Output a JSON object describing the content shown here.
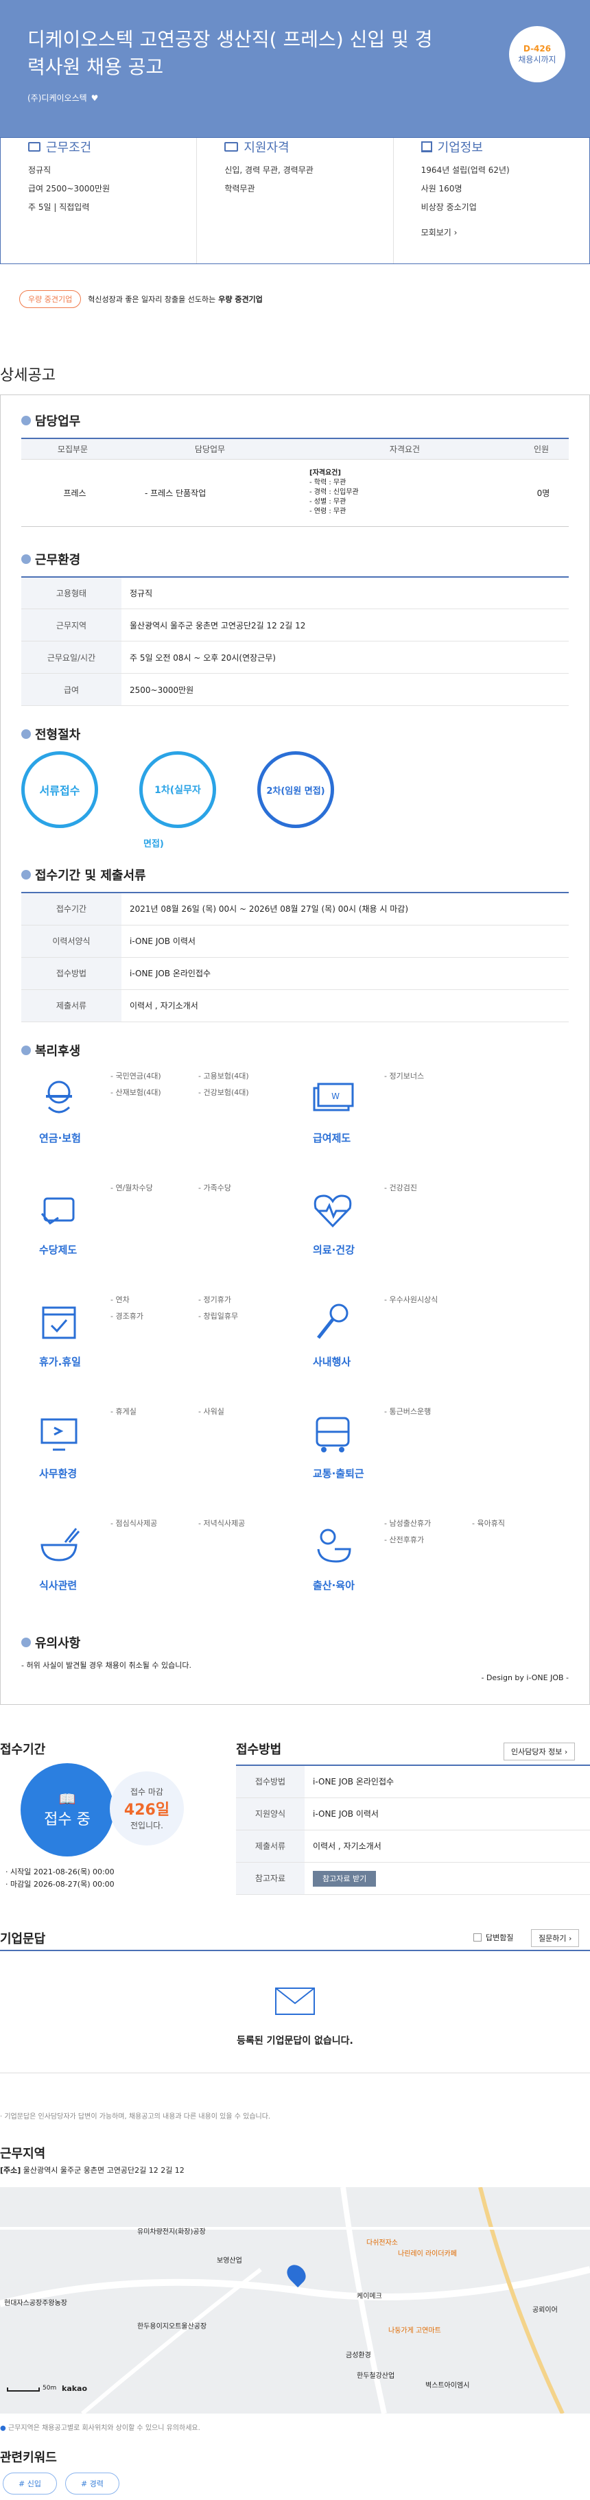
{
  "header": {
    "title": "디케이오스텍 고연공장 생산직( 프레스) 신입 및 경력사원 채용 공고",
    "company": "(주)디케이오스텍",
    "dday": "D-426",
    "dday_sub": "채용시까지"
  },
  "summary": [
    {
      "title": "근무조건",
      "icon": "briefcase-icon",
      "lines": [
        "정규직",
        "급여 2500~3000만원",
        "주 5일 | 직접입력"
      ]
    },
    {
      "title": "지원자격",
      "icon": "id-card-icon",
      "lines": [
        "신입, 경력 무관, 경력무관",
        "학력무관"
      ]
    },
    {
      "title": "기업정보",
      "icon": "building-icon",
      "lines": [
        "1964년 설립(업력 62년)",
        "사원 160명",
        "비상장 중소기업"
      ],
      "more": "모회보기 ›"
    }
  ],
  "tag": {
    "badge": "우량 중견기업",
    "text": "혁신성장과 좋은 일자리 창출을 선도하는",
    "bold": "우량 중견기업"
  },
  "detail_title": "상세공고",
  "duty": {
    "title": "담당업무",
    "headers": [
      "모집부문",
      "담당업무",
      "자격요건",
      "인원"
    ],
    "row": {
      "part": "프레스",
      "task": "- 프레스 단품작업",
      "req": [
        "[자격요건]",
        "- 학력 : 무관",
        "- 경력 : 신입무관",
        "- 성별 : 무관",
        "- 연령 : 무관"
      ],
      "count": "0명"
    }
  },
  "env": {
    "title": "근무환경",
    "rows": [
      [
        "고용형태",
        "정규직"
      ],
      [
        "근무지역",
        "울산광역시 울주군 웅촌면 고연공단2길 12 2길 12"
      ],
      [
        "근무요일/시간",
        "주 5일 오전 08시 ~ 오후 20시(연장근무)"
      ],
      [
        "급여",
        "2500~3000만원"
      ]
    ]
  },
  "process": {
    "title": "전형절차",
    "steps": [
      "서류접수",
      "1차(실무자",
      "2차(임원 면접)"
    ],
    "extra": "면접)"
  },
  "apply": {
    "title": "접수기간 및 제출서류",
    "rows": [
      [
        "접수기간",
        "2021년 08월 26일 (목) 00시 ~ 2026년 08월 27일 (목) 00시 (채용 시 마감)"
      ],
      [
        "이력서양식",
        "i-ONE JOB 이력서"
      ],
      [
        "접수방법",
        "i-ONE JOB 온라인접수"
      ],
      [
        "제출서류",
        "이력서 , 자기소개서"
      ]
    ]
  },
  "welfare": {
    "title": "복리후생",
    "items": [
      {
        "label": "연금·보험",
        "icon": "pension-icon",
        "texts": [
          "- 국민연금(4대)",
          "- 고용보험(4대)",
          "- 산재보험(4대)",
          "- 건강보험(4대)"
        ]
      },
      {
        "label": "급여제도",
        "icon": "money-icon",
        "texts": [
          "- 정기보너스"
        ]
      },
      {
        "label": "수당제도",
        "icon": "allowance-icon",
        "texts": [
          "- 연/월차수당",
          "- 가족수당"
        ]
      },
      {
        "label": "의료·건강",
        "icon": "health-icon",
        "texts": [
          "- 건강검진"
        ]
      },
      {
        "label": "휴가.휴일",
        "icon": "calendar-icon",
        "texts": [
          "- 연차",
          "- 정기휴가",
          "- 경조휴가",
          "- 창립일휴무"
        ]
      },
      {
        "label": "사내행사",
        "icon": "microphone-icon",
        "texts": [
          "- 우수사원시상식"
        ]
      },
      {
        "label": "사무환경",
        "icon": "monitor-icon",
        "texts": [
          "- 휴게실",
          "- 사워실"
        ]
      },
      {
        "label": "교통·출퇴근",
        "icon": "bus-icon",
        "texts": [
          "- 통근버스운행"
        ]
      },
      {
        "label": "식사관련",
        "icon": "meal-icon",
        "texts": [
          "- 점심식사제공",
          "- 저녁식사제공"
        ]
      },
      {
        "label": "출산·육아",
        "icon": "duck-icon",
        "texts": [
          "- 남성출산휴가",
          "- 육아휴직",
          "- 산전후휴가"
        ]
      }
    ]
  },
  "notice": {
    "title": "유의사항",
    "text": "- 허위 사실이 발견될 경우 채용이 취소될 수 있습니다.",
    "design": "- Design by i-ONE JOB -"
  },
  "period": {
    "title": "접수기간",
    "status": "접수 중",
    "deadline_label": "접수 마감",
    "days": "426일",
    "days_suffix": "전입니다.",
    "start": "· 시작일 2021-08-26(목) 00:00",
    "end": "· 마감일 2026-08-27(목) 00:00"
  },
  "method": {
    "title": "접수방법",
    "hr_btn": "인사담당자 정보 ›",
    "rows": [
      [
        "접수방법",
        "i-ONE JOB 온라인접수"
      ],
      [
        "지원양식",
        "i-ONE JOB 이력서"
      ],
      [
        "제출서류",
        "이력서 , 자기소개서"
      ],
      [
        "참고자료",
        ""
      ]
    ],
    "attach_btn": "참고자료 받기"
  },
  "qa": {
    "title": "기업문답",
    "answered": "답변함질",
    "ask_btn": "질문하기 ›",
    "empty": "등록된 기업문답이 없습니다.",
    "note": "· 기업문답은 인사담당자가 답변이 가능하며, 채용공고의 내용과 다른 내용이 있을 수 있습니다."
  },
  "location": {
    "title": "근무지역",
    "address_label": "[주소]",
    "address": "울산광역시 울주군 웅촌면 고연공단2길 12 2길 12",
    "map_labels": [
      "유미차량전지(화장)공장",
      "보영산업",
      "케이메크",
      "한두용이지오트울산공장",
      "현대자스공장주왕농장",
      "금성환경",
      "한두철강산업",
      "벽스트아이엠시",
      "나린레이 라이더카페",
      "다쉬전자소",
      "나둥가게 고연마트",
      "공뢰이어"
    ],
    "scale": "50m",
    "brand": "kakao",
    "note": "근무지역은 채용공고별로 회사위치와 상이할 수 있으니 유의하세요."
  },
  "keywords": {
    "title": "관련키워드",
    "items": [
      "# 신입",
      "# 경력"
    ]
  }
}
